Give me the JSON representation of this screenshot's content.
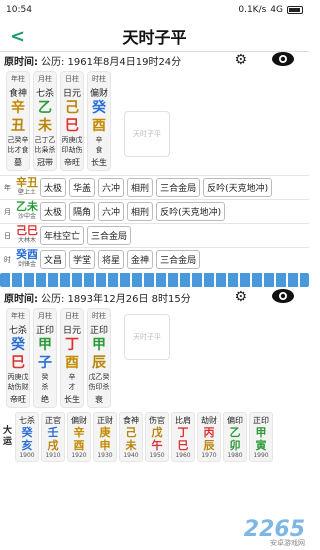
{
  "status": {
    "time": "10:54",
    "speed": "0.1K/s",
    "network": "4G"
  },
  "nav": {
    "title": "天时子平",
    "back": "<"
  },
  "chart1": {
    "label": "原时间:",
    "date": "公历: 1961年8月4日19时24分",
    "pillars": [
      {
        "head": "年柱",
        "god": "食神",
        "stem": "辛",
        "branch": "丑",
        "hidden": [
          "己癸辛",
          "比才食"
        ],
        "state": "墓"
      },
      {
        "head": "月柱",
        "god": "七杀",
        "stem": "乙",
        "branch": "未",
        "hidden": [
          "己丁乙",
          "比枭杀"
        ],
        "state": "冠带"
      },
      {
        "head": "日柱",
        "god": "日元",
        "stem": "己",
        "branch": "巳",
        "hidden": [
          "丙庚戊",
          "印劫伤"
        ],
        "state": "帝旺"
      },
      {
        "head": "时柱",
        "god": "偏财",
        "stem": "癸",
        "branch": "酉",
        "hidden": [
          "辛",
          "食"
        ],
        "state": "长生"
      }
    ],
    "seal": "天时子平",
    "rows": [
      {
        "tag": "年",
        "pair": "辛丑",
        "nayin": "壁上土",
        "chips": [
          "太极",
          "华盖",
          "六冲",
          "相刑",
          "三合金局",
          "反吟(天克地冲)"
        ]
      },
      {
        "tag": "月",
        "pair": "乙未",
        "nayin": "沙中金",
        "chips": [
          "太极",
          "隔角",
          "六冲",
          "相刑",
          "反吟(天克地冲)"
        ]
      },
      {
        "tag": "日",
        "pair": "己巳",
        "nayin": "大林木",
        "chips": [
          "年柱空亡",
          "三合金局"
        ]
      },
      {
        "tag": "时",
        "pair": "癸酉",
        "nayin": "剑锋金",
        "chips": [
          "文昌",
          "学堂",
          "将星",
          "金神",
          "三合金局"
        ]
      }
    ]
  },
  "chart2": {
    "label": "原时间:",
    "date": "公历: 1893年12月26日 8时15分",
    "pillars": [
      {
        "head": "年柱",
        "god": "七杀",
        "stem": "癸",
        "branch": "巳",
        "hidden": [
          "丙庚戊",
          "劫伤财"
        ],
        "state": "帝旺"
      },
      {
        "head": "月柱",
        "god": "正印",
        "stem": "甲",
        "branch": "子",
        "hidden": [
          "癸",
          "杀"
        ],
        "state": "绝"
      },
      {
        "head": "日柱",
        "god": "日元",
        "stem": "丁",
        "branch": "酉",
        "hidden": [
          "辛",
          "才"
        ],
        "state": "长生"
      },
      {
        "head": "时柱",
        "god": "正印",
        "stem": "甲",
        "branch": "辰",
        "hidden": [
          "戊乙癸",
          "伤印杀"
        ],
        "state": "衰"
      }
    ],
    "seal": "天时子平",
    "dayun_label": "大运",
    "dayun": [
      {
        "god": "七杀",
        "stem": "癸",
        "branch": "亥",
        "yr": "1900"
      },
      {
        "god": "正官",
        "stem": "壬",
        "branch": "戌",
        "yr": "1910"
      },
      {
        "god": "偏财",
        "stem": "辛",
        "branch": "酉",
        "yr": "1920"
      },
      {
        "god": "正财",
        "stem": "庚",
        "branch": "申",
        "yr": "1930"
      },
      {
        "god": "食神",
        "stem": "己",
        "branch": "未",
        "yr": "1940"
      },
      {
        "god": "伤官",
        "stem": "戊",
        "branch": "午",
        "yr": "1950"
      },
      {
        "god": "比肩",
        "stem": "丁",
        "branch": "巳",
        "yr": "1960"
      },
      {
        "god": "劫财",
        "stem": "丙",
        "branch": "辰",
        "yr": "1970"
      },
      {
        "god": "偏印",
        "stem": "乙",
        "branch": "卯",
        "yr": "1980"
      },
      {
        "god": "正印",
        "stem": "甲",
        "branch": "寅",
        "yr": "1990"
      }
    ]
  },
  "watermark": "2265",
  "watermark_sub": "安卓游戏网",
  "colors": {
    "accent": "#1a9b6d",
    "wave": "#2a86d6"
  }
}
